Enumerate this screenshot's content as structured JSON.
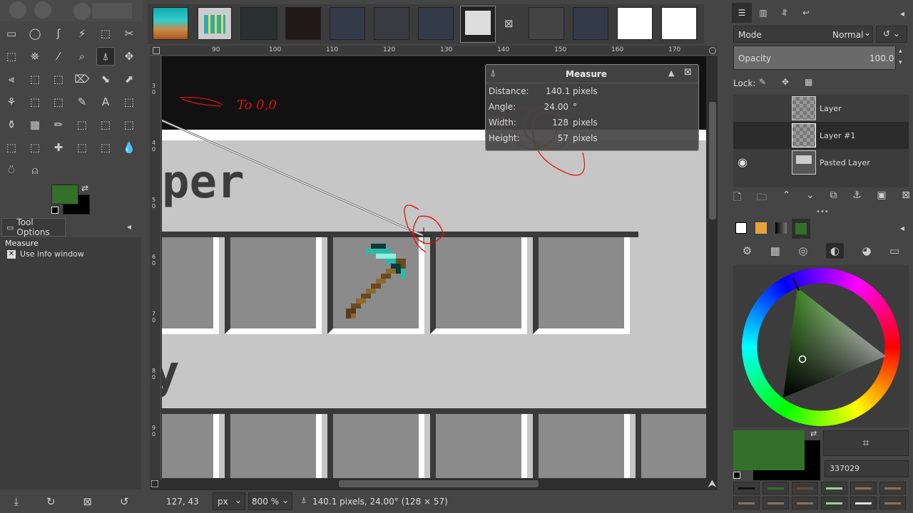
{
  "toolbox": {
    "tool_options_title": "Tool Options",
    "tool_name": "Measure",
    "use_info_window_label": "Use info window"
  },
  "ruler": {
    "h_labels": [
      "90",
      "100",
      "110",
      "120",
      "130",
      "140",
      "150",
      "160",
      "170"
    ],
    "v_labels": [
      "3 0",
      "4 0",
      "5 0",
      "6 0",
      "7 0",
      "8 0",
      "9 0"
    ]
  },
  "canvas": {
    "annotation": "To 0,0",
    "text_per": "per",
    "text_y": "y"
  },
  "measure": {
    "title": "Measure",
    "distance_label": "Distance:",
    "distance_value": "140.1",
    "distance_unit": "pixels",
    "angle_label": "Angle:",
    "angle_value": "24.00",
    "angle_unit": "°",
    "width_label": "Width:",
    "width_value": "128",
    "width_unit": "pixels",
    "height_label": "Height:",
    "height_value": "57",
    "height_unit": "pixels"
  },
  "status": {
    "coords": "127, 43",
    "unit": "px",
    "zoom": "800 %",
    "message": "140.1 pixels, 24.00° (128 × 57)"
  },
  "layers": {
    "mode_label": "Mode",
    "mode_value": "Normal",
    "opacity_label": "Opacity",
    "opacity_value": "100.0",
    "lock_label": "Lock:",
    "items": [
      {
        "name": "Layer"
      },
      {
        "name": "Layer #1"
      },
      {
        "name": "Pasted Layer"
      }
    ]
  },
  "colors": {
    "fg": "#337029",
    "bg": "#000000",
    "hex_value": "337029",
    "history": [
      "#111111",
      "#337029",
      "#6b4a3a",
      "#a8c8a8",
      "#8a7060",
      "#8a7060",
      "#8a7060",
      "#8a7060",
      "#8a7060",
      "#a8c8a8",
      "#e0e0e0",
      "#8a7060"
    ]
  }
}
